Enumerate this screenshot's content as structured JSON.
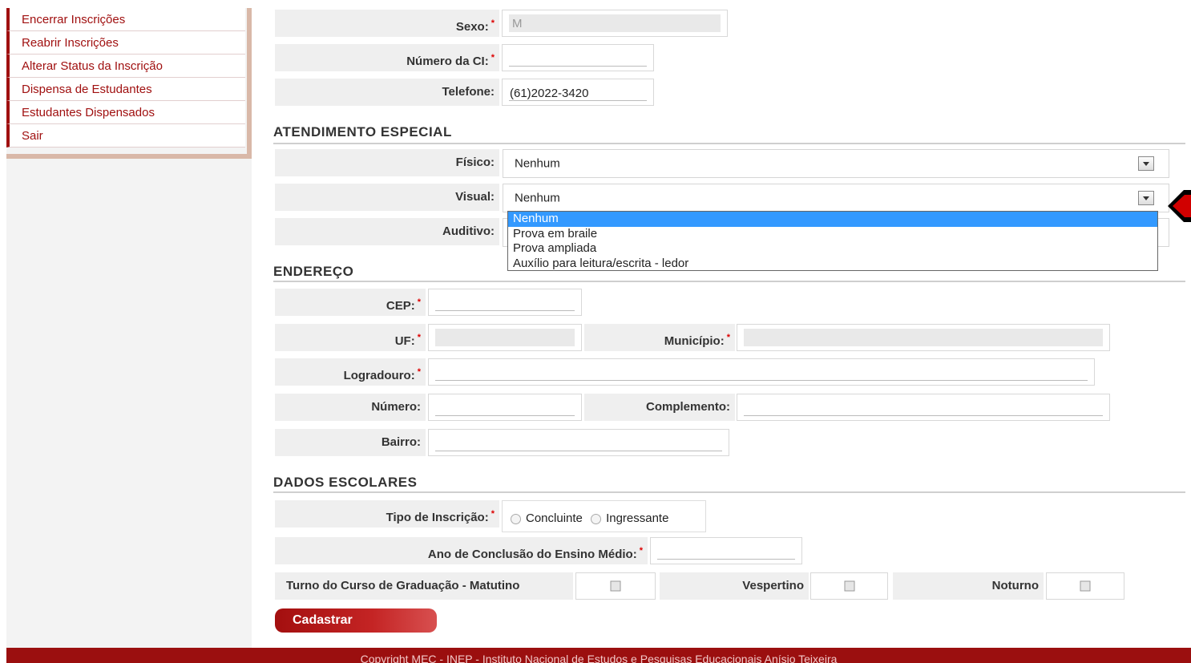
{
  "sidebar": {
    "items": [
      {
        "label": "Encerrar Inscrições"
      },
      {
        "label": "Reabrir Inscrições"
      },
      {
        "label": "Alterar Status da Inscrição"
      },
      {
        "label": "Dispensa de Estudantes"
      },
      {
        "label": "Estudantes Dispensados"
      },
      {
        "label": "Sair"
      }
    ]
  },
  "personal": {
    "sexo_label": "Sexo:",
    "sexo_value": "M",
    "ci_label": "Número da CI:",
    "ci_value": "",
    "telefone_label": "Telefone:",
    "telefone_value": "(61)2022-3420"
  },
  "atendimento": {
    "title": "ATENDIMENTO ESPECIAL",
    "fisico_label": "Físico:",
    "fisico_value": "Nenhum",
    "visual_label": "Visual:",
    "visual_value": "Nenhum",
    "auditivo_label": "Auditivo:",
    "visual_options": [
      "Nenhum",
      "Prova em braile",
      "Prova ampliada",
      "Auxílio para leitura/escrita - ledor"
    ],
    "visual_selected_index": 0
  },
  "endereco": {
    "title": "ENDEREÇO",
    "cep_label": "CEP:",
    "uf_label": "UF:",
    "municipio_label": "Município:",
    "logradouro_label": "Logradouro:",
    "numero_label": "Número:",
    "complemento_label": "Complemento:",
    "bairro_label": "Bairro:"
  },
  "escolares": {
    "title": "DADOS ESCOLARES",
    "tipo_label": "Tipo de Inscrição:",
    "opt_concluinte": "Concluinte",
    "opt_ingressante": "Ingressante",
    "ano_label": "Ano de Conclusão do Ensino Médio:",
    "turno_label": "Turno do Curso de Graduação - Matutino",
    "vespertino_label": "Vespertino",
    "noturno_label": "Noturno"
  },
  "actions": {
    "cadastrar_label": "Cadastrar"
  },
  "footer": {
    "text": "Copyright MEC - INEP - Instituto Nacional de Estudos e Pesquisas Educacionais Anísio Teixeira"
  },
  "colors": {
    "brand": "#a01010",
    "highlight": "#3399ff"
  }
}
